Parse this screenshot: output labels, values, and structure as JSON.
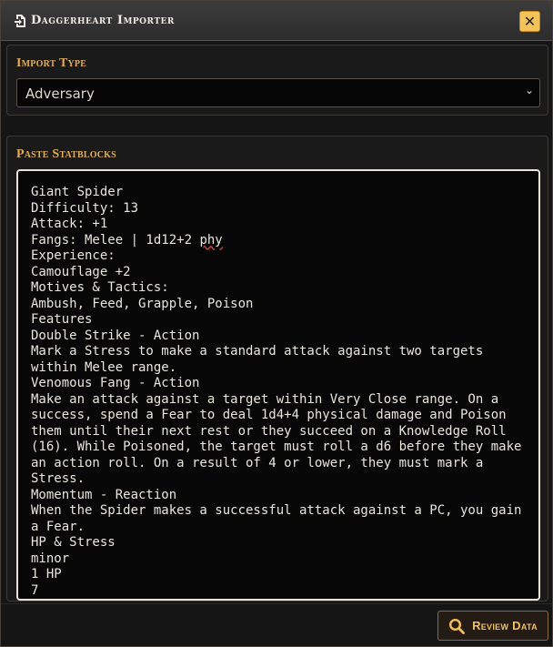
{
  "window": {
    "title": "Daggerheart Importer",
    "close_label": "✕"
  },
  "import_type": {
    "label": "Import Type",
    "selected": "Adversary",
    "arrow": "⌄"
  },
  "statblocks": {
    "label": "Paste Statblocks",
    "lines_before": "Giant Spider\nDifficulty: 13\nAttack: +1\nFangs: Melee | 1d12+2 ",
    "spell_word": "phy",
    "lines_after": "\nExperience:\nCamouflage +2\nMotives & Tactics:\nAmbush, Feed, Grapple, Poison\nFeatures\nDouble Strike - Action\nMark a Stress to make a standard attack against two targets within Melee range.\nVenomous Fang - Action\nMake an attack against a target within Very Close range. On a success, spend a Fear to deal 1d4+4 physical damage and Poison them until their next rest or they succeed on a Knowledge Roll (16). While Poisoned, the target must roll a d6 before they make an action roll. On a result of 4 or lower, they must mark a Stress.\nMomentum - Reaction\nWhen the Spider makes a successful attack against a PC, you gain a Fear.\nHP & Stress\nminor\n1 HP\n7"
  },
  "footer": {
    "review_label": "Review Data"
  },
  "icons": {
    "title": "file-import-icon",
    "close": "close-icon",
    "review": "search-icon"
  },
  "colors": {
    "accent_gold": "#e3ad52",
    "button_gold": "#f4c45a"
  }
}
